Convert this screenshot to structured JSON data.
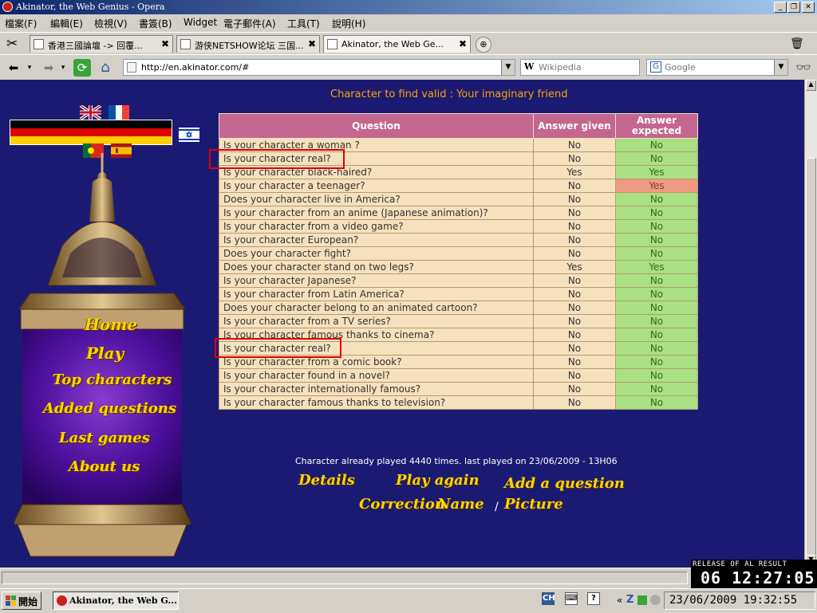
{
  "window": {
    "title": "Akinator, the Web Genius - Opera",
    "min": "_",
    "max": "❐",
    "close": "✕"
  },
  "menu": [
    "檔案(F)",
    "編輯(E)",
    "檢視(V)",
    "書簽(B)",
    "Widget",
    "電子郵件(A)",
    "工具(T)",
    "說明(H)"
  ],
  "tabs": [
    {
      "label": "香港三國論壇 -> 回覆...",
      "close": "✖"
    },
    {
      "label": "游侠NETSHOW论坛 三国...",
      "close": "✖"
    },
    {
      "label": "Akinator, the Web Ge...",
      "close": "✖"
    }
  ],
  "address": {
    "url": "http://en.akinator.com/#",
    "search1": "Wikipedia",
    "search1_icon": "W",
    "search2": "Google",
    "search2_icon": "G"
  },
  "page": {
    "headline": "Character to find valid : Your imaginary friend",
    "menu_links": [
      "Home",
      "Play",
      "Top characters",
      "Added questions",
      "Last games",
      "About us"
    ],
    "table": {
      "headers": [
        "Question",
        "Answer given",
        "Answer expected"
      ],
      "rows": [
        {
          "q": "Is your character a woman ?",
          "given": "No",
          "expected": "No",
          "mismatch": false
        },
        {
          "q": "Is your character real?",
          "given": "No",
          "expected": "No",
          "mismatch": false
        },
        {
          "q": "Is your character black-haired?",
          "given": "Yes",
          "expected": "Yes",
          "mismatch": false
        },
        {
          "q": "Is your character a teenager?",
          "given": "No",
          "expected": "Yes",
          "mismatch": true
        },
        {
          "q": "Does your character live in America?",
          "given": "No",
          "expected": "No",
          "mismatch": false
        },
        {
          "q": "Is your character from an anime (Japanese animation)?",
          "given": "No",
          "expected": "No",
          "mismatch": false
        },
        {
          "q": "Is your character from a video game?",
          "given": "No",
          "expected": "No",
          "mismatch": false
        },
        {
          "q": "Is your character European?",
          "given": "No",
          "expected": "No",
          "mismatch": false
        },
        {
          "q": "Does your character fight?",
          "given": "No",
          "expected": "No",
          "mismatch": false
        },
        {
          "q": "Does your character stand on two legs?",
          "given": "Yes",
          "expected": "Yes",
          "mismatch": false
        },
        {
          "q": "Is your character Japanese?",
          "given": "No",
          "expected": "No",
          "mismatch": false
        },
        {
          "q": "Is your character from Latin America?",
          "given": "No",
          "expected": "No",
          "mismatch": false
        },
        {
          "q": "Does your character belong to an animated cartoon?",
          "given": "No",
          "expected": "No",
          "mismatch": false
        },
        {
          "q": "Is your character from a TV series?",
          "given": "No",
          "expected": "No",
          "mismatch": false
        },
        {
          "q": "Is your character famous thanks to cinema?",
          "given": "No",
          "expected": "No",
          "mismatch": false
        },
        {
          "q": "Is your character real?",
          "given": "No",
          "expected": "No",
          "mismatch": false
        },
        {
          "q": "Is your character from a comic book?",
          "given": "No",
          "expected": "No",
          "mismatch": false
        },
        {
          "q": "Is your character found in a novel?",
          "given": "No",
          "expected": "No",
          "mismatch": false
        },
        {
          "q": "Is your character internationally famous?",
          "given": "No",
          "expected": "No",
          "mismatch": false
        },
        {
          "q": "Is your character famous thanks to television?",
          "given": "No",
          "expected": "No",
          "mismatch": false
        }
      ]
    },
    "played_text": "Character already played 4440 times. last played on 23/06/2009 - 13H06",
    "actions": {
      "details": "Details",
      "play_again": "Play again",
      "add_question": "Add a question",
      "correction": "Correction",
      "name": "Name",
      "sep": "/",
      "picture": "Picture"
    }
  },
  "overlay": {
    "line1": "RELEASE OF AL RESULT",
    "line2": "06 12:27:05"
  },
  "taskbar": {
    "start": "開始",
    "task": "Akinator, the Web G...",
    "ime": "CH",
    "clock": "23/06/2009 19:32:55"
  },
  "colors": {
    "page_bg": "#1b1a72",
    "headline": "#ffa000",
    "header_bg": "#c4678f",
    "cell_bg": "#f5e2bc",
    "ok_bg": "#a8e083",
    "bad_bg": "#f09a84",
    "link": "#ffd400",
    "highlight": "#e00000"
  }
}
